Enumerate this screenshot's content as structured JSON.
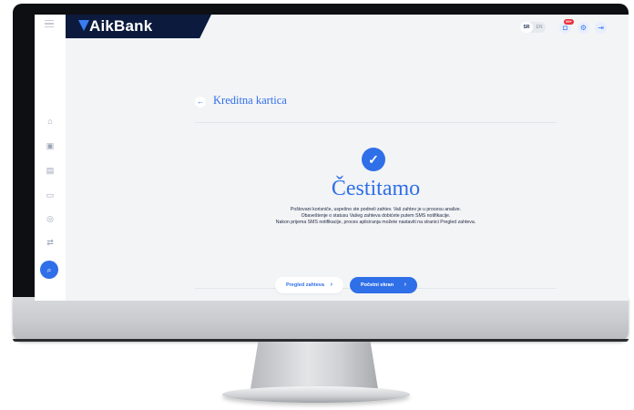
{
  "app": {
    "brand": "AikBank",
    "colors": {
      "accent": "#2f6fe8",
      "brand_dark": "#0b1a3d",
      "badge": "#e8303b"
    }
  },
  "header": {
    "lang": {
      "sr": "SR",
      "en": "EN"
    },
    "notifications_badge": "99+",
    "icons": [
      "bell-icon",
      "settings-icon",
      "logout-icon"
    ]
  },
  "sidebar": {
    "items": [
      {
        "name": "home-icon"
      },
      {
        "name": "accounts-icon"
      },
      {
        "name": "cards-icon"
      },
      {
        "name": "wallet-icon"
      },
      {
        "name": "payments-icon"
      },
      {
        "name": "transfer-icon"
      },
      {
        "name": "requests-icon",
        "active": true
      }
    ]
  },
  "page": {
    "title": "Kreditna kartica",
    "heading": "Čestitamo",
    "message_lines": [
      "Poštovani korisniče, uspešno ste podneli zahtev. Vaš zahtev je u procesu analize.",
      "Obaveštenje o statusu Vašeg zahteva dobićete putem SMS notifikacije.",
      "Nakon prijema SMS notifikacije, proces apliciranja možete nastaviti na stranici Pregled zahteva."
    ],
    "buttons": {
      "review": "Pregled zahteva",
      "home": "Početni ekran"
    }
  }
}
